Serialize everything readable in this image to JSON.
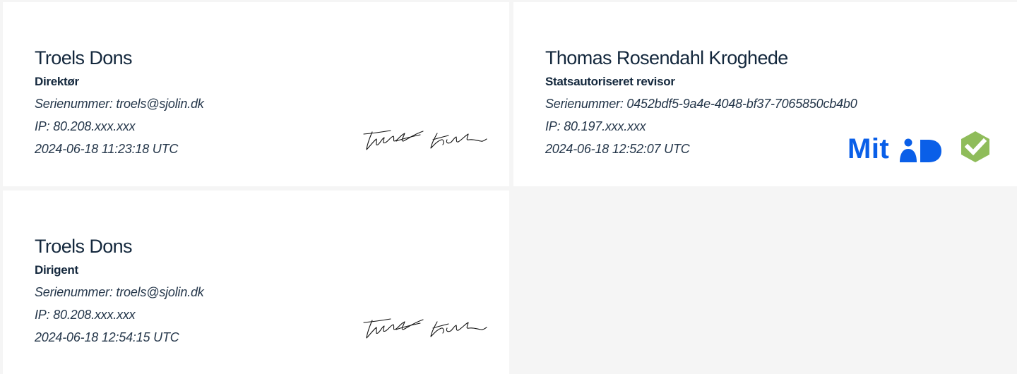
{
  "signers": [
    {
      "name": "Troels Dons",
      "role": "Direktør",
      "serial": "Serienummer: troels@sjolin.dk",
      "ip": "IP: 80.208.xxx.xxx",
      "timestamp": "2024-06-18 11:23:18 UTC",
      "signature_text": "Troels Dons"
    },
    {
      "name": "Thomas Rosendahl Kroghede",
      "role": "Statsautoriseret revisor",
      "serial": "Serienummer: 0452bdf5-9a4e-4048-bf37-7065850cb4b0",
      "ip": "IP: 80.197.xxx.xxx",
      "timestamp": "2024-06-18 12:52:07 UTC",
      "logo_text": "Mit",
      "badge_icon": "check-shield-icon"
    },
    {
      "name": "Troels Dons",
      "role": "Dirigent",
      "serial": "Serienummer: troels@sjolin.dk",
      "ip": "IP: 80.208.xxx.xxx",
      "timestamp": "2024-06-18 12:54:15 UTC",
      "signature_text": "Troels Dons"
    }
  ],
  "colors": {
    "name": "#14283d",
    "mitid_blue": "#0a5fe8",
    "badge_green": "#8fbc5a",
    "background": "#f5f5f5",
    "card": "#ffffff"
  }
}
